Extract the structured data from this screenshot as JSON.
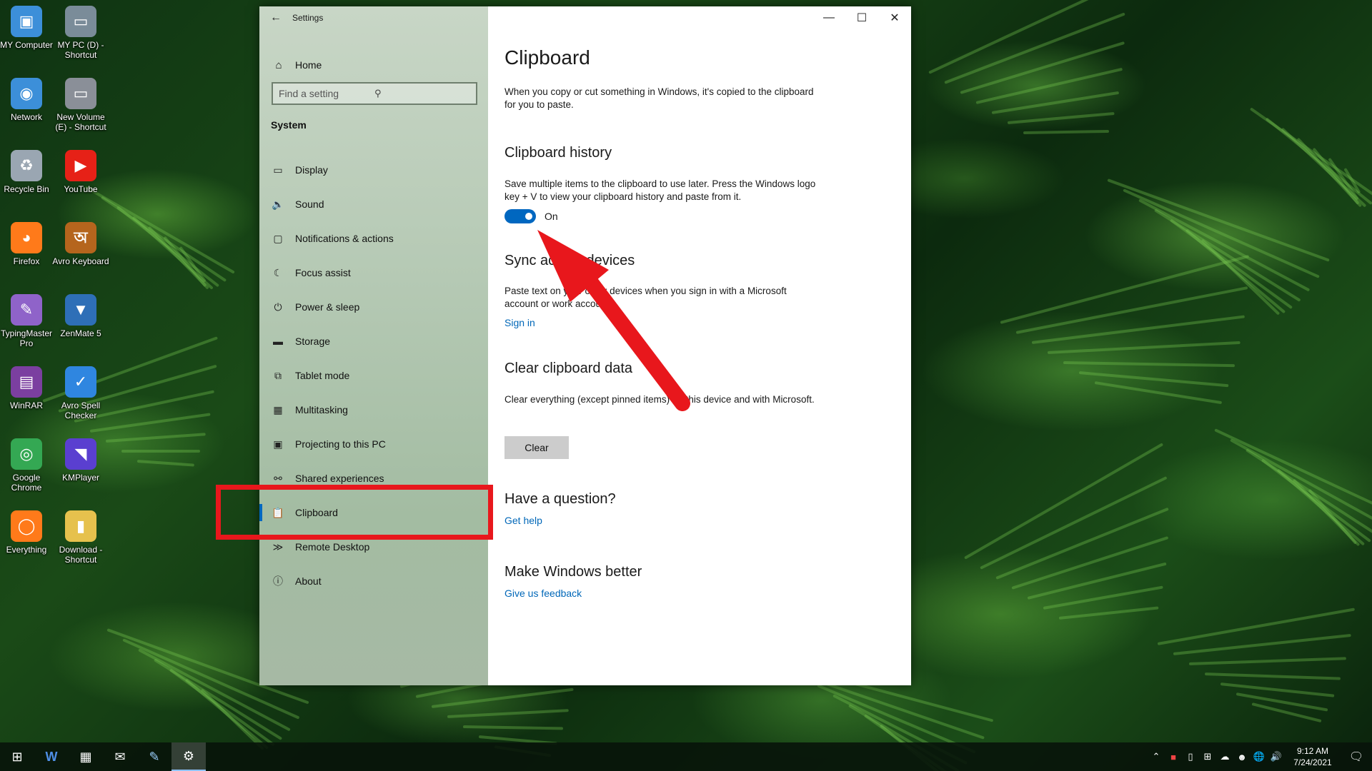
{
  "desktop": {
    "icons": [
      {
        "label": "MY Computer",
        "icon": "computer-icon"
      },
      {
        "label": "MY PC (D) - Shortcut",
        "icon": "drive-icon"
      },
      {
        "label": "Network",
        "icon": "network-icon"
      },
      {
        "label": "New Volume (E) - Shortcut",
        "icon": "drive-icon"
      },
      {
        "label": "Recycle Bin",
        "icon": "recycle-bin-icon"
      },
      {
        "label": "YouTube",
        "icon": "youtube-icon"
      },
      {
        "label": "Firefox",
        "icon": "firefox-icon"
      },
      {
        "label": "Avro Keyboard",
        "icon": "avro-keyboard-icon"
      },
      {
        "label": "TypingMaster Pro",
        "icon": "typingmaster-icon"
      },
      {
        "label": "ZenMate 5",
        "icon": "zenmate-icon"
      },
      {
        "label": "WinRAR",
        "icon": "winrar-icon"
      },
      {
        "label": "Avro Spell Checker",
        "icon": "avro-spell-checker-icon"
      },
      {
        "label": "Google Chrome",
        "icon": "chrome-icon"
      },
      {
        "label": "KMPlayer",
        "icon": "kmplayer-icon"
      },
      {
        "label": "Everything",
        "icon": "everything-icon"
      },
      {
        "label": "Download - Shortcut",
        "icon": "folder-icon"
      }
    ]
  },
  "window": {
    "title": "Settings",
    "controls": {
      "minimize": "—",
      "maximize": "☐",
      "close": "✕"
    }
  },
  "nav": {
    "home_label": "Home",
    "search_placeholder": "Find a setting",
    "section_title": "System",
    "items": [
      {
        "label": "Display",
        "icon": "display-icon"
      },
      {
        "label": "Sound",
        "icon": "sound-icon"
      },
      {
        "label": "Notifications & actions",
        "icon": "notifications-icon"
      },
      {
        "label": "Focus assist",
        "icon": "focus-assist-icon"
      },
      {
        "label": "Power & sleep",
        "icon": "power-icon"
      },
      {
        "label": "Storage",
        "icon": "storage-icon"
      },
      {
        "label": "Tablet mode",
        "icon": "tablet-mode-icon"
      },
      {
        "label": "Multitasking",
        "icon": "multitasking-icon"
      },
      {
        "label": "Projecting to this PC",
        "icon": "projecting-icon"
      },
      {
        "label": "Shared experiences",
        "icon": "shared-experiences-icon"
      },
      {
        "label": "Clipboard",
        "icon": "clipboard-icon",
        "active": true
      },
      {
        "label": "Remote Desktop",
        "icon": "remote-desktop-icon"
      },
      {
        "label": "About",
        "icon": "about-icon"
      }
    ]
  },
  "main": {
    "title": "Clipboard",
    "intro": "When you copy or cut something in Windows, it's copied to the clipboard for you to paste.",
    "history": {
      "heading": "Clipboard history",
      "description": "Save multiple items to the clipboard to use later. Press the Windows logo key + V to view your clipboard history and paste from it.",
      "toggle_state": "On",
      "toggle_on": true
    },
    "sync": {
      "heading": "Sync across devices",
      "description": "Paste text on your other devices when you sign in with a Microsoft account or work account.",
      "link": "Sign in"
    },
    "clear": {
      "heading": "Clear clipboard data",
      "description": "Clear everything (except pinned items) on this device and with Microsoft.",
      "button": "Clear"
    },
    "question": {
      "heading": "Have a question?",
      "link": "Get help"
    },
    "better": {
      "heading": "Make Windows better",
      "link": "Give us feedback"
    }
  },
  "taskbar": {
    "apps": [
      "windows-start-icon",
      "word-icon",
      "calculator-icon",
      "mail-icon",
      "notepad-icon",
      "settings-gear-icon"
    ],
    "time": "9:12 AM",
    "date": "7/24/2021"
  },
  "colors": {
    "accent": "#0067c0",
    "link": "#0067b8",
    "annotation_red": "#e8171c"
  }
}
